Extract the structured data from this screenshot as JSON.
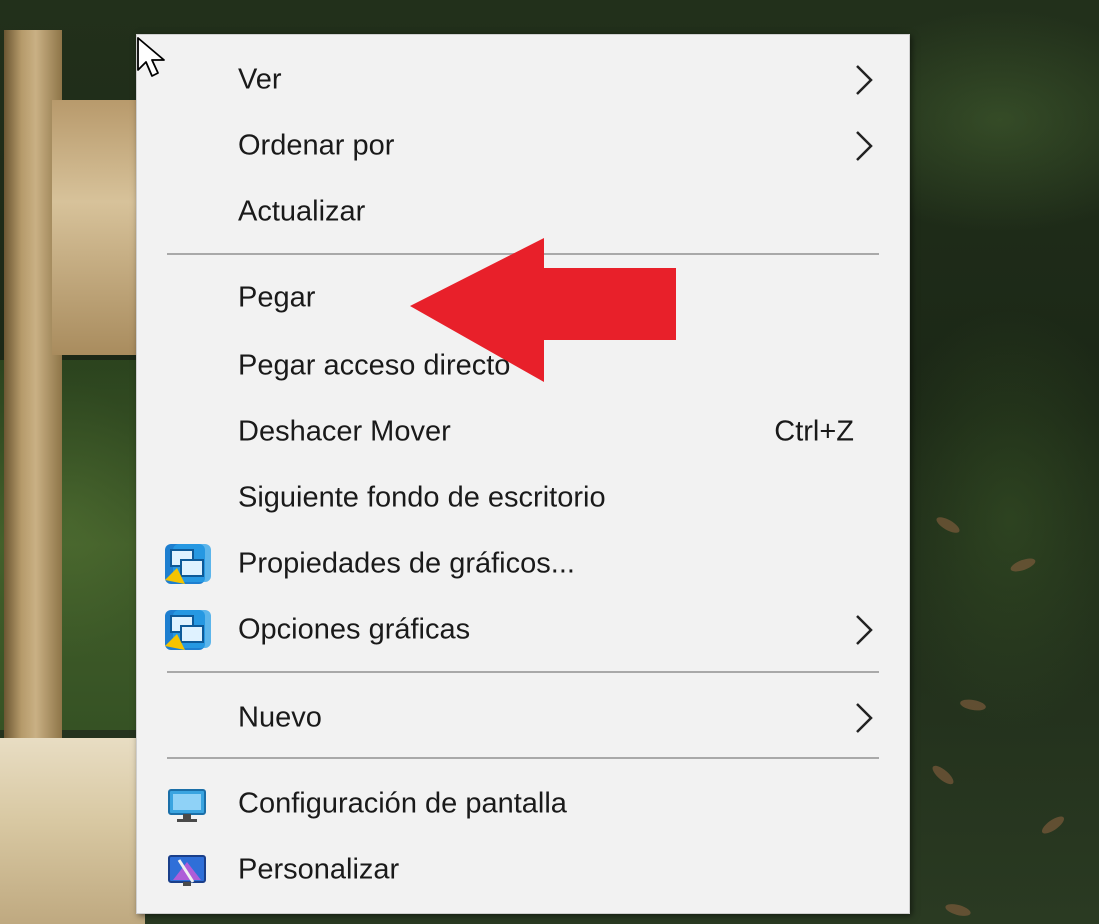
{
  "menu": {
    "items": [
      {
        "label": "Ver",
        "submenu": true
      },
      {
        "label": "Ordenar por",
        "submenu": true
      },
      {
        "label": "Actualizar"
      },
      {
        "label": "Pegar"
      },
      {
        "label": "Pegar acceso directo"
      },
      {
        "label": "Deshacer Mover",
        "shortcut": "Ctrl+Z"
      },
      {
        "label": "Siguiente fondo de escritorio"
      },
      {
        "label": "Propiedades de gráficos...",
        "icon": "intel-graphics-icon"
      },
      {
        "label": "Opciones gráficas",
        "icon": "intel-graphics-icon",
        "submenu": true
      },
      {
        "label": "Nuevo",
        "submenu": true
      },
      {
        "label": "Configuración de pantalla",
        "icon": "display-settings-icon"
      },
      {
        "label": "Personalizar",
        "icon": "personalize-icon"
      }
    ]
  },
  "annotation": {
    "icon": "red-arrow-icon",
    "color": "#e8202a"
  },
  "colors": {
    "menu_bg": "#f2f2f2",
    "separator": "#a9a9a9",
    "text": "#1a1a1a"
  }
}
